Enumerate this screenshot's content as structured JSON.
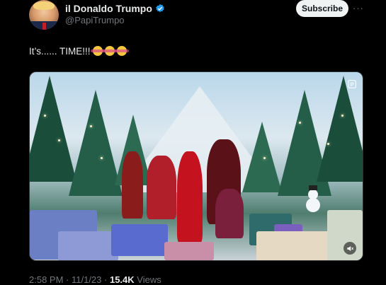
{
  "author": {
    "name": "il Donaldo Trumpo",
    "handle": "@PapiTrumpo",
    "verified": true
  },
  "actions": {
    "subscribe_label": "Subscribe",
    "more_label": "···"
  },
  "tweet": {
    "text": "It’s...... TIME!!!",
    "emoji_count": 3
  },
  "meta": {
    "time": "2:58 PM",
    "separator": " · ",
    "date": "11/1/23",
    "views_count": "15.4K",
    "views_label": "Views"
  },
  "colors": {
    "background": "#000000",
    "text": "#e7e9ea",
    "muted": "#71767b",
    "verified": "#1d9bf0",
    "subscribe_bg": "#eff3f4"
  },
  "icons": {
    "verified": "verified-badge-icon",
    "sound": "speaker-muted-icon",
    "media_settings": "media-settings-icon"
  }
}
